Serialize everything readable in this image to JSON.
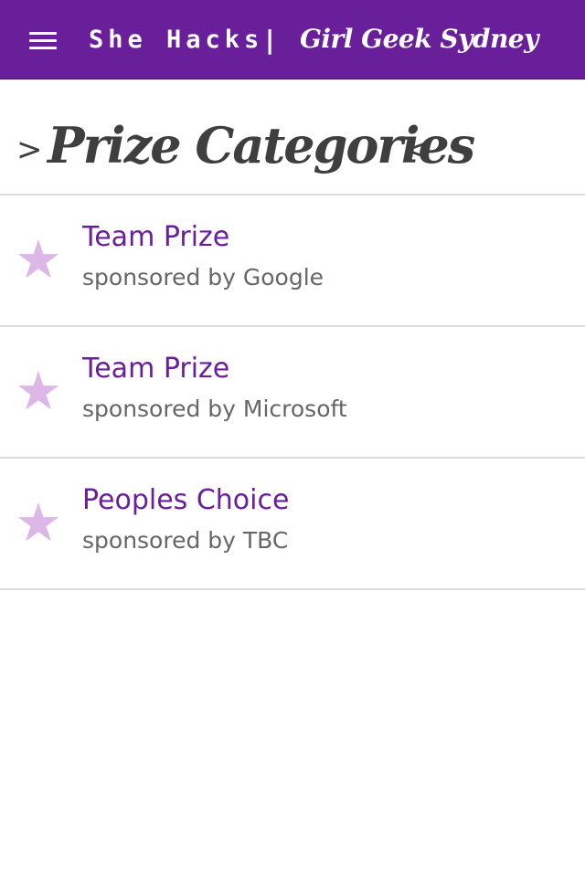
{
  "header": {
    "menu_icon": "hamburger-menu-icon",
    "brand": "She Hacks",
    "separator": "|",
    "subtitle": "Girl Geek Sydney",
    "background_color": "#6a1f9a"
  },
  "page": {
    "arrow_left": ">",
    "title": "Prize Categories",
    "arrow_right": "<"
  },
  "prizes": [
    {
      "icon": "star-icon",
      "name": "Team Prize",
      "sponsor": "sponsored by Google"
    },
    {
      "icon": "star-icon",
      "name": "Team Prize",
      "sponsor": "sponsored by Microsoft"
    },
    {
      "icon": "star-icon",
      "name": "Peoples Choice",
      "sponsor": "sponsored by TBC"
    }
  ],
  "colors": {
    "accent": "#6a1f9a",
    "star": "#dcb7e8",
    "heading_text": "#3f3f3f",
    "sponsor_text": "#666666",
    "divider": "#dcdcdc"
  }
}
